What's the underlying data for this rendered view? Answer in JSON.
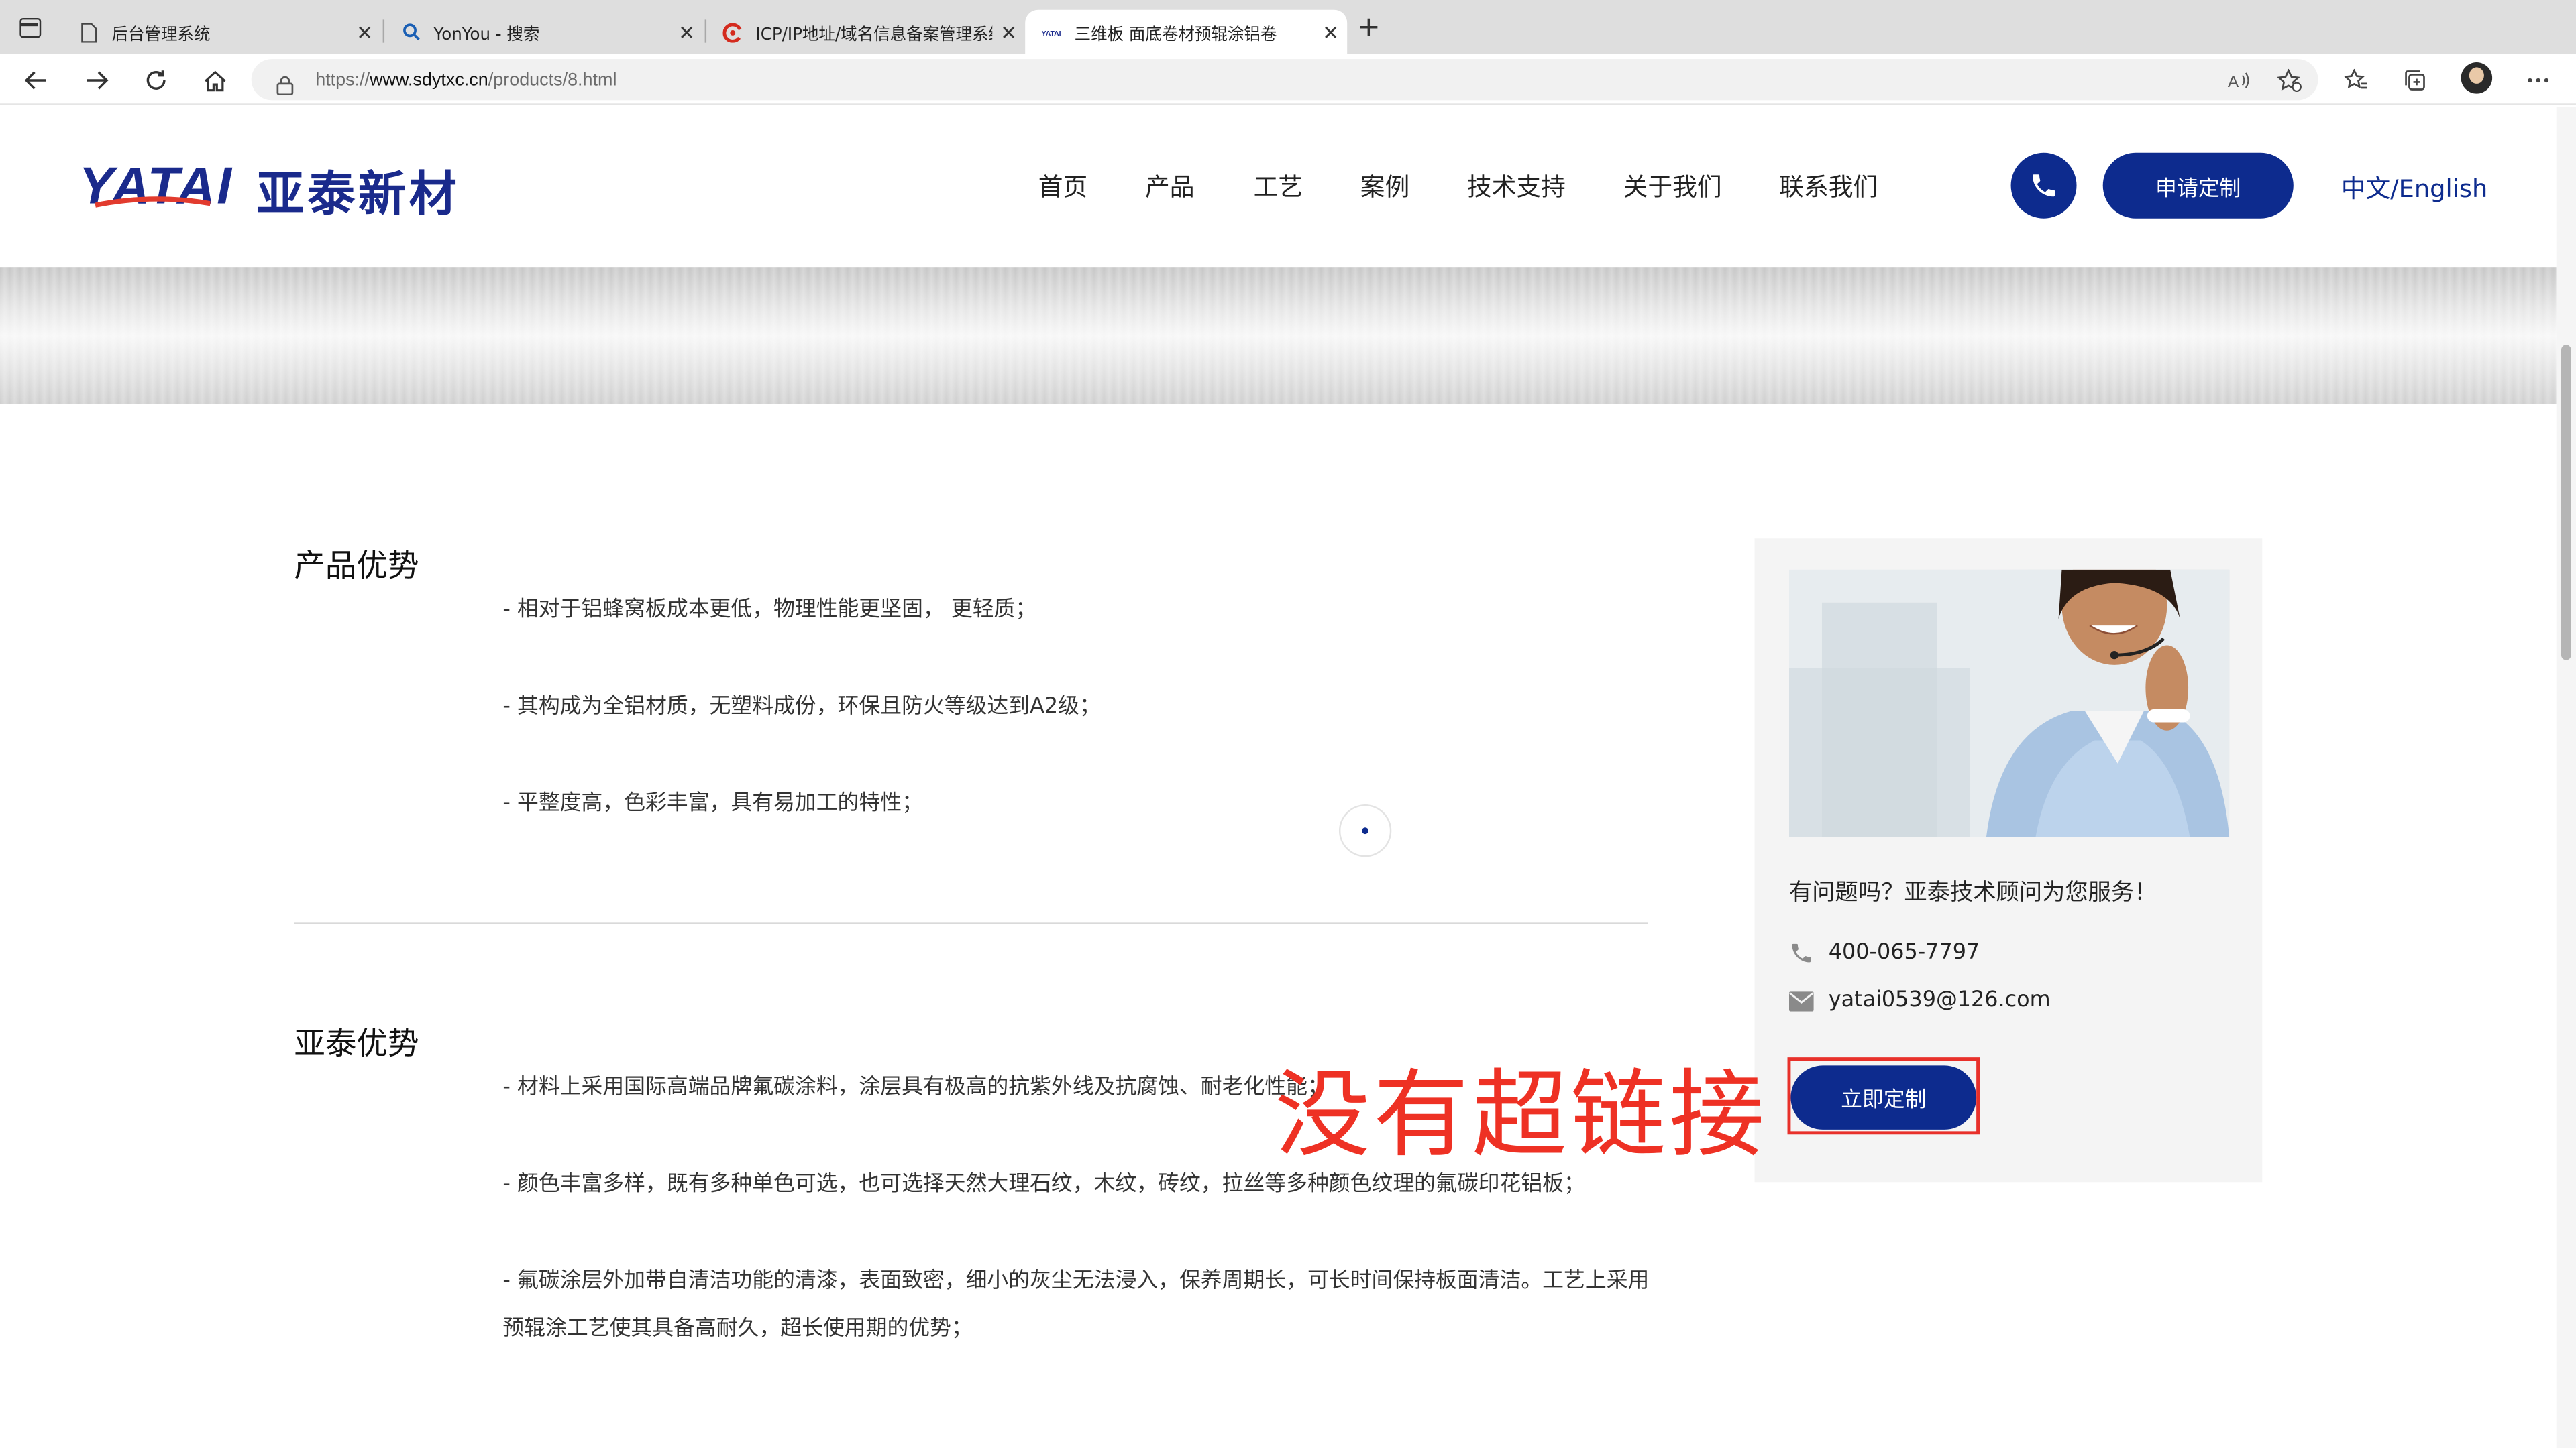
{
  "browser": {
    "tabs": [
      {
        "title": "后台管理系统",
        "icon": "page-icon"
      },
      {
        "title": "YonYou - 搜索",
        "icon": "search-icon"
      },
      {
        "title": "ICP/IP地址/域名信息备案管理系统",
        "icon": "icp-icon"
      },
      {
        "title": "三维板 面底卷材预辊涂铝卷",
        "icon": "yatai-icon"
      }
    ],
    "url_prefix": "https://",
    "url_domain": "www.sdytxc.cn",
    "url_path": "/products/8.html"
  },
  "site": {
    "logo_en": "YATAI",
    "logo_cn": "亚泰新材",
    "nav": [
      "首页",
      "产品",
      "工艺",
      "案例",
      "技术支持",
      "关于我们",
      "联系我们"
    ],
    "apply_button": "申请定制",
    "language": "中文/English",
    "brand_color": "#0d2b8e"
  },
  "content": {
    "section1": {
      "title": "产品优势",
      "items": [
        "- 相对于铝蜂窝板成本更低，物理性能更坚固， 更轻质；",
        "- 其构成为全铝材质，无塑料成份，环保且防火等级达到A2级；",
        "- 平整度高，色彩丰富，具有易加工的特性；"
      ]
    },
    "section2": {
      "title": "亚泰优势",
      "items": [
        "- 材料上采用国际高端品牌氟碳涂料，涂层具有极高的抗紫外线及抗腐蚀、耐老化性能；",
        "- 颜色丰富多样，既有多种单色可选，也可选择天然大理石纹，木纹，砖纹，拉丝等多种颜色纹理的氟碳印花铝板；",
        "- 氟碳涂层外加带自清洁功能的清漆，表面致密，细小的灰尘无法浸入，保养周期长，可长时间保持板面清洁。工艺上采用预辊涂工艺使其具备高耐久，超长使用期的优势；"
      ]
    }
  },
  "sidebar": {
    "question": "有问题吗？亚泰技术顾问为您服务！",
    "phone": "400-065-7797",
    "email": "yatai0539@126.com",
    "cta_button": "立即定制"
  },
  "annotation": {
    "text": "没有超链接",
    "color": "#ee3124"
  }
}
